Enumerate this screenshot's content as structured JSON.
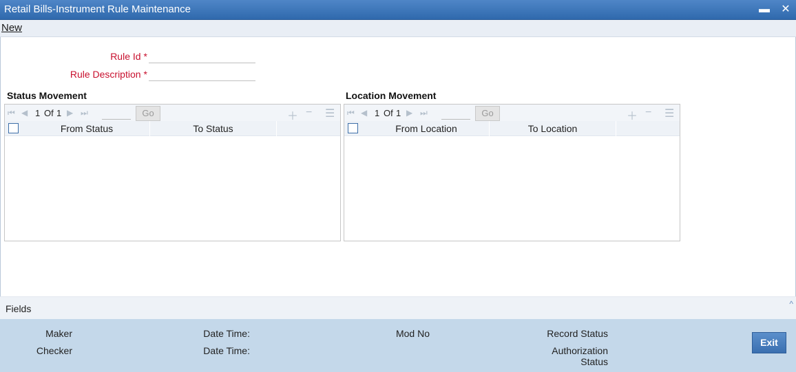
{
  "window": {
    "title": "Retail Bills-Instrument Rule Maintenance",
    "minimize_glyph": "▬",
    "close_glyph": "✕"
  },
  "menu": {
    "new_label": "New"
  },
  "form": {
    "rule_id_label": "Rule Id",
    "rule_id_value": "",
    "rule_desc_label": "Rule Description",
    "rule_desc_value": "",
    "required_mark": "*"
  },
  "status_grid": {
    "title": "Status Movement",
    "page_current": "1",
    "page_of": "Of",
    "page_total": "1",
    "go_label": "Go",
    "columns": [
      "From Status",
      "To Status"
    ]
  },
  "location_grid": {
    "title": "Location Movement",
    "page_current": "1",
    "page_of": "Of",
    "page_total": "1",
    "go_label": "Go",
    "columns": [
      "From Location",
      "To Location"
    ]
  },
  "fields_section": {
    "label": "Fields",
    "caret": "^"
  },
  "footer": {
    "maker_label": "Maker",
    "checker_label": "Checker",
    "date_time_label_1": "Date Time:",
    "date_time_label_2": "Date Time:",
    "mod_no_label": "Mod No",
    "record_status_label": "Record Status",
    "auth_status_label_line1": "Authorization",
    "auth_status_label_line2": "Status",
    "exit_label": "Exit"
  },
  "icons": {
    "first": "first-page-icon",
    "prev": "prev-page-icon",
    "next": "next-page-icon",
    "last": "last-page-icon",
    "add": "add-row-icon",
    "delete": "delete-row-icon",
    "view": "single-view-icon"
  },
  "colors": {
    "title_bar": "#3a73b8",
    "required": "#c8102e",
    "footer_bg": "#c4d8ea"
  }
}
